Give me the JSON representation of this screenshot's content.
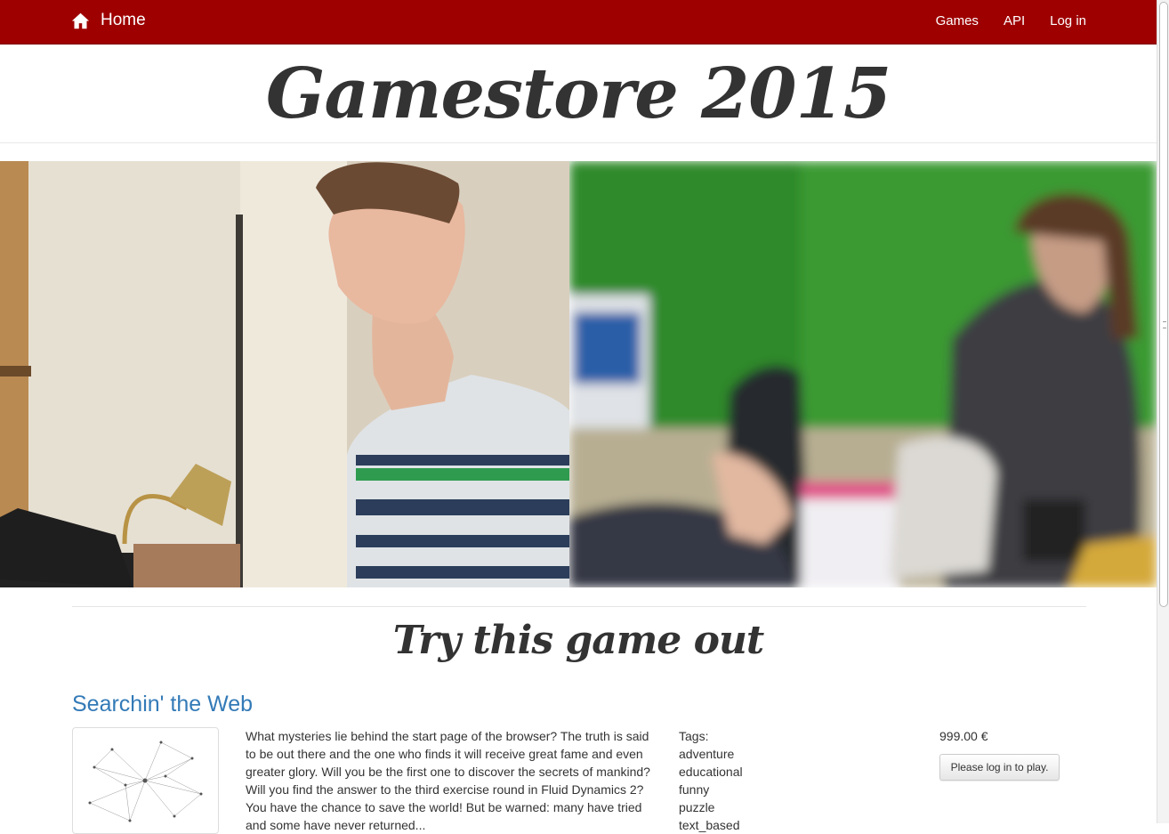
{
  "navbar": {
    "brand_label": "Home",
    "links": [
      "Games",
      "API",
      "Log in"
    ],
    "background_color": "#9e0000"
  },
  "header": {
    "title": "Gamestore 2015"
  },
  "featured": {
    "section_title": "Try this game out",
    "game": {
      "title": "Searchin' the Web",
      "description": "What mysteries lie behind the start page of the browser? The truth is said to be out there and the one who finds it will receive great fame and even greater glory. Will you be the first one to discover the secrets of mankind? Will you find the answer to the third exercise round in Fluid Dynamics 2? You have the chance to save the world! But be warned: many have tried and some have never returned...",
      "tags_label": "Tags:",
      "tags": [
        "adventure",
        "educational",
        "funny",
        "puzzle",
        "text_based"
      ],
      "price": "999.00 €",
      "play_button_label": "Please log in to play."
    }
  },
  "icons": {
    "home": "home-icon"
  }
}
